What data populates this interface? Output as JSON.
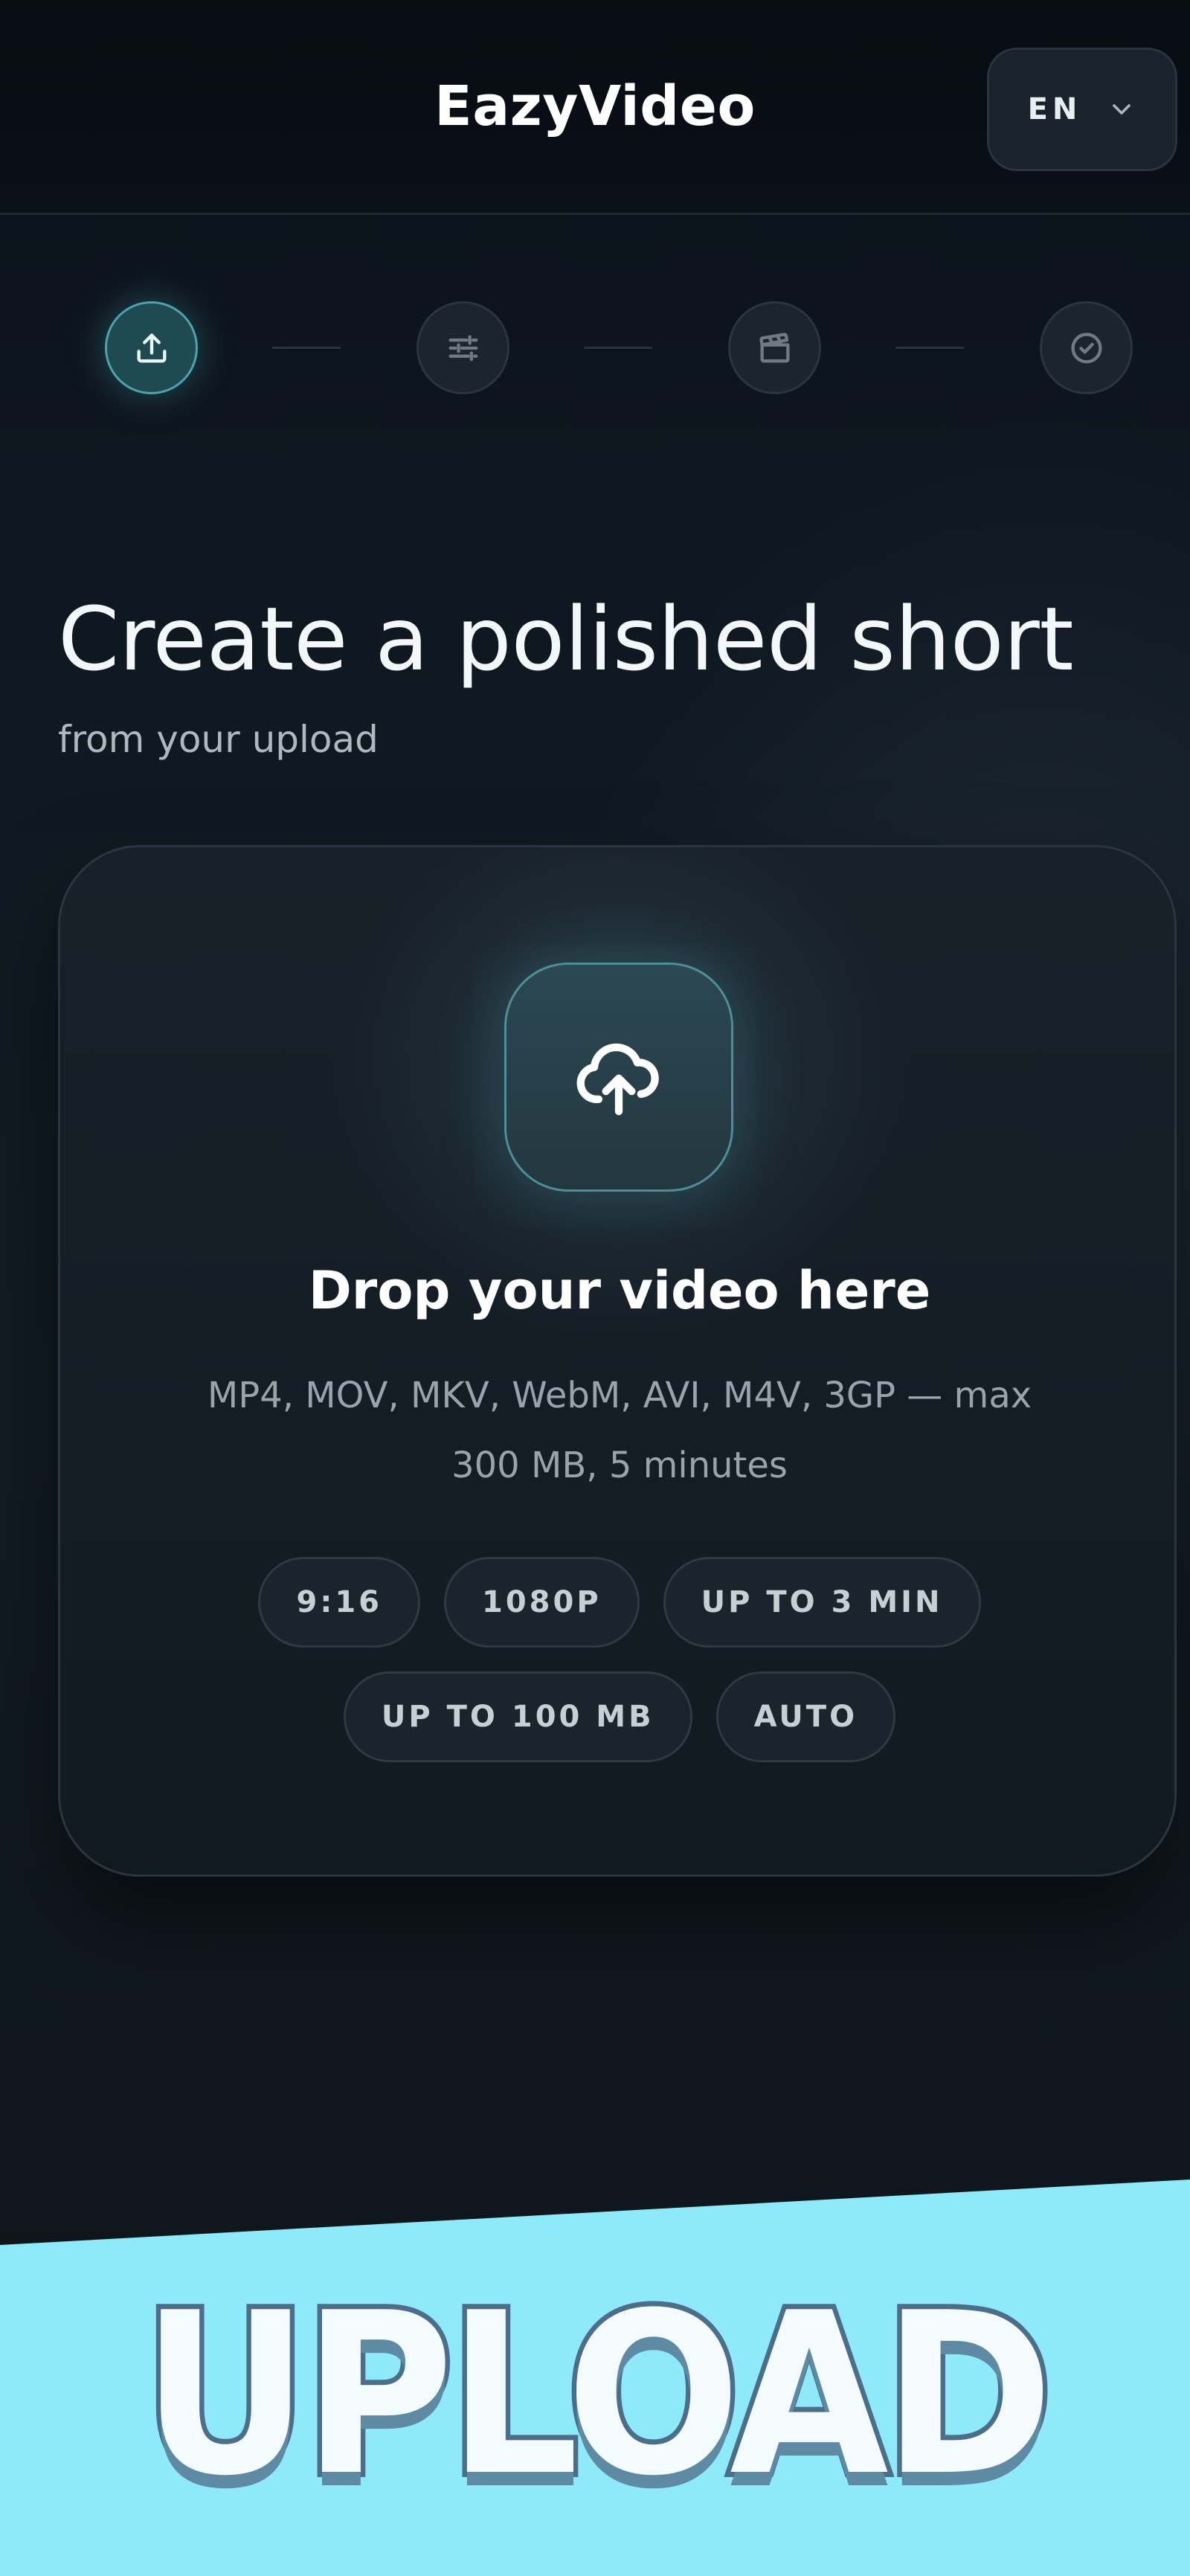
{
  "header": {
    "brand": "EazyVideo",
    "language": {
      "label": "EN",
      "icon": "chevron-down-icon"
    }
  },
  "stepper": {
    "steps": [
      {
        "icon": "upload-icon",
        "active": true
      },
      {
        "icon": "sliders-icon",
        "active": false
      },
      {
        "icon": "clapperboard-icon",
        "active": false
      },
      {
        "icon": "check-circle-icon",
        "active": false
      }
    ]
  },
  "hero": {
    "title": "Create a polished short",
    "subtitle": "from your upload"
  },
  "upload": {
    "icon": "cloud-upload-icon",
    "title": "Drop your video here",
    "description": "MP4, MOV, MKV, WebM, AVI, M4V, 3GP — max 300 MB, 5 minutes",
    "chips": [
      "9:16",
      "1080P",
      "UP TO 3 MIN",
      "UP TO 100 MB",
      "AUTO"
    ]
  },
  "banner": {
    "text": "UPLOAD"
  },
  "colors": {
    "accent": "#4aa3ad",
    "banner_bg": "#8eeaf8",
    "banner_stroke": "#4d6e8a"
  }
}
